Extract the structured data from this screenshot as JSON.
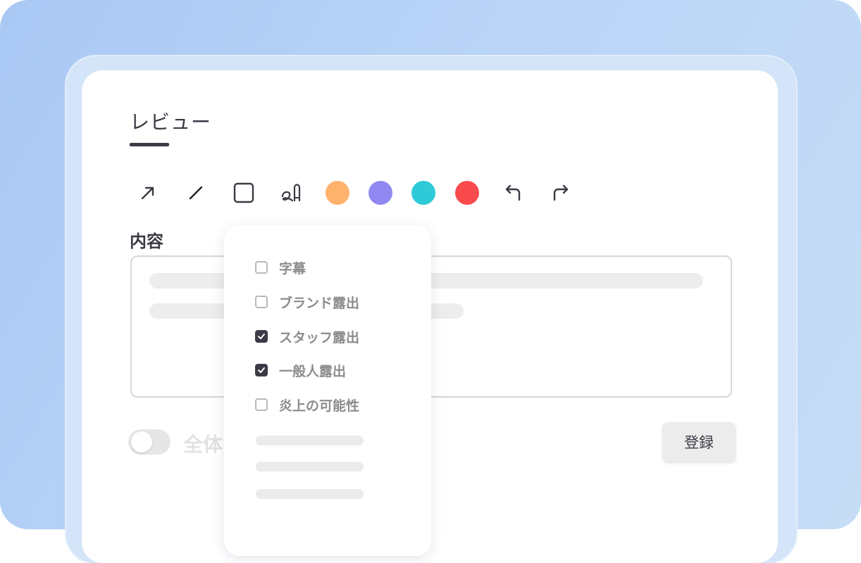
{
  "header": {
    "tab_label": "レビュー"
  },
  "toolbar": {
    "tools": [
      {
        "name": "arrow"
      },
      {
        "name": "line"
      },
      {
        "name": "rectangle"
      },
      {
        "name": "freehand"
      }
    ],
    "colors": [
      "#ffb26b",
      "#9088f0",
      "#2fcad8",
      "#f94a4e"
    ],
    "actions": [
      "undo",
      "redo"
    ]
  },
  "content": {
    "label": "内容"
  },
  "toggle": {
    "label": "全体",
    "on": false
  },
  "submit_label": "登録",
  "dropdown": {
    "options": [
      {
        "label": "字幕",
        "checked": false
      },
      {
        "label": "ブランド露出",
        "checked": false
      },
      {
        "label": "スタッフ露出",
        "checked": true
      },
      {
        "label": "一般人露出",
        "checked": true
      },
      {
        "label": "炎上の可能性",
        "checked": false
      }
    ]
  }
}
